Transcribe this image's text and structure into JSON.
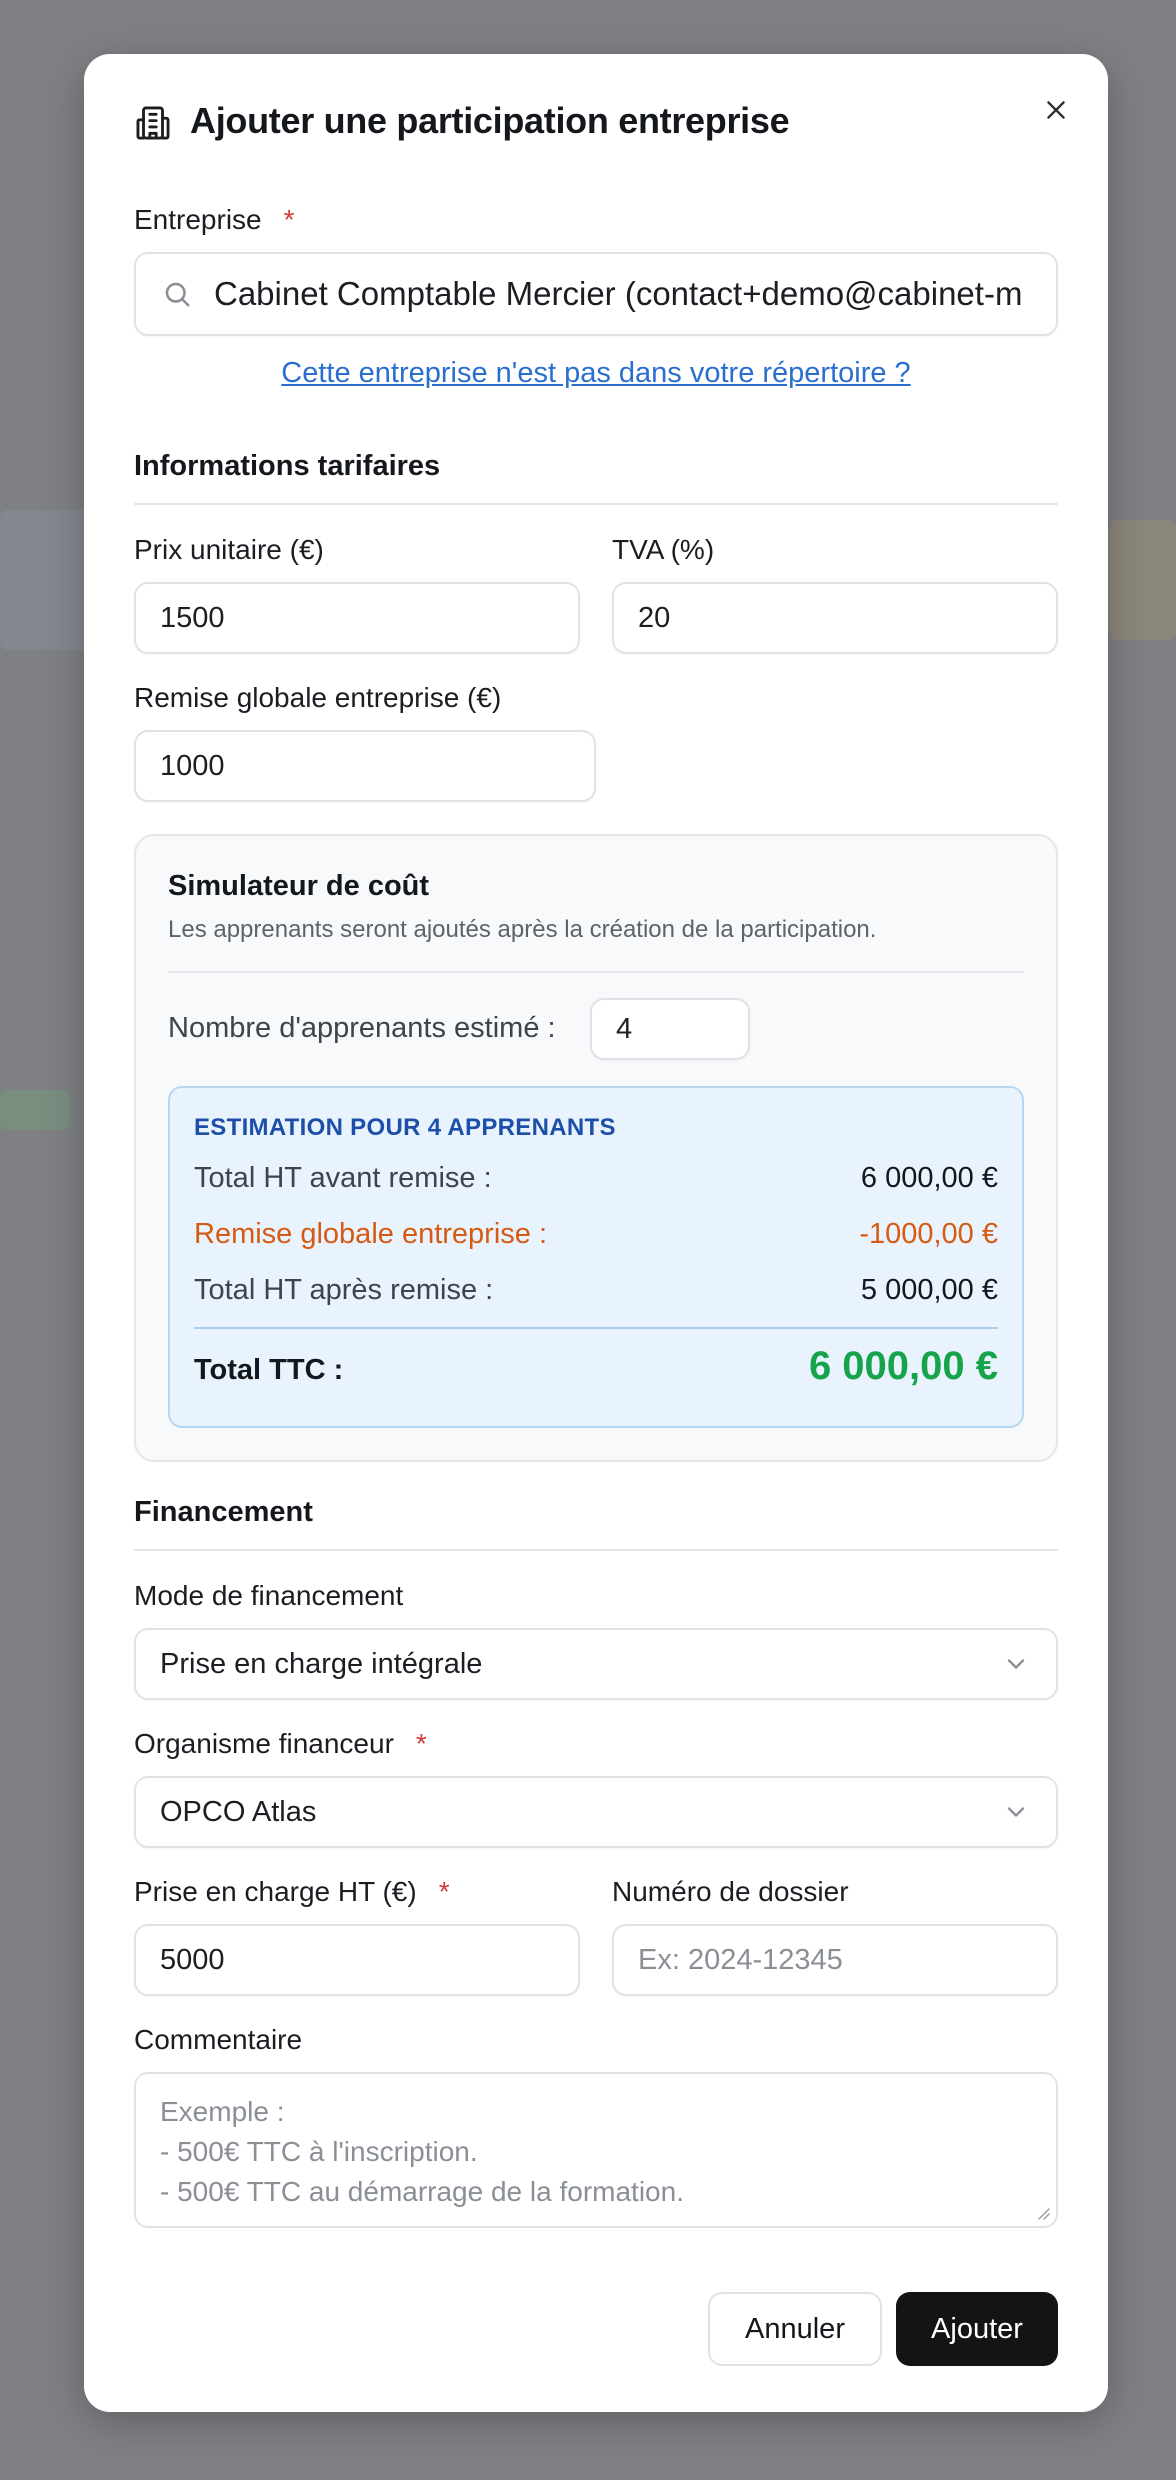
{
  "dialog": {
    "title": "Ajouter une participation entreprise"
  },
  "company": {
    "label": "Entreprise",
    "required_mark": "*",
    "value": "Cabinet Comptable Mercier (contact+demo@cabinet-m",
    "not_in_directory_link": "Cette entreprise n'est pas dans votre répertoire ?"
  },
  "pricing": {
    "section_title": "Informations tarifaires",
    "unit_price_label": "Prix unitaire (€)",
    "unit_price_value": "1500",
    "vat_label": "TVA (%)",
    "vat_value": "20",
    "discount_label": "Remise globale entreprise (€)",
    "discount_value": "1000"
  },
  "simulator": {
    "title": "Simulateur de coût",
    "subtitle": "Les apprenants seront ajoutés après la création de la participation.",
    "learners_label": "Nombre d'apprenants estimé :",
    "learners_value": "4",
    "estimate_title": "ESTIMATION POUR 4 APPRENANTS",
    "rows": [
      {
        "label": "Total HT avant remise :",
        "value": "6 000,00 €"
      },
      {
        "label": "Remise globale entreprise :",
        "value": "-1000,00 €"
      },
      {
        "label": "Total HT après remise :",
        "value": "5 000,00 €"
      }
    ],
    "total_label": "Total TTC :",
    "total_value": "6 000,00 €"
  },
  "financing": {
    "section_title": "Financement",
    "mode_label": "Mode de financement",
    "mode_value": "Prise en charge intégrale",
    "funder_label": "Organisme financeur",
    "funder_required_mark": "*",
    "funder_value": "OPCO Atlas",
    "coverage_label": "Prise en charge HT (€)",
    "coverage_required_mark": "*",
    "coverage_value": "5000",
    "file_number_label": "Numéro de dossier",
    "file_number_placeholder": "Ex: 2024-12345",
    "comment_label": "Commentaire",
    "comment_placeholder_lines": [
      "Exemple :",
      "- 500€ TTC à l'inscription.",
      "- 500€ TTC au démarrage de la formation."
    ]
  },
  "actions": {
    "cancel_label": "Annuler",
    "submit_label": "Ajouter"
  },
  "colors": {
    "accent_link": "#2a6fcf",
    "discount_orange": "#d65a12",
    "total_green": "#16a34a",
    "estimate_title_blue": "#1e4fa8",
    "required_red": "#d33a3a"
  }
}
